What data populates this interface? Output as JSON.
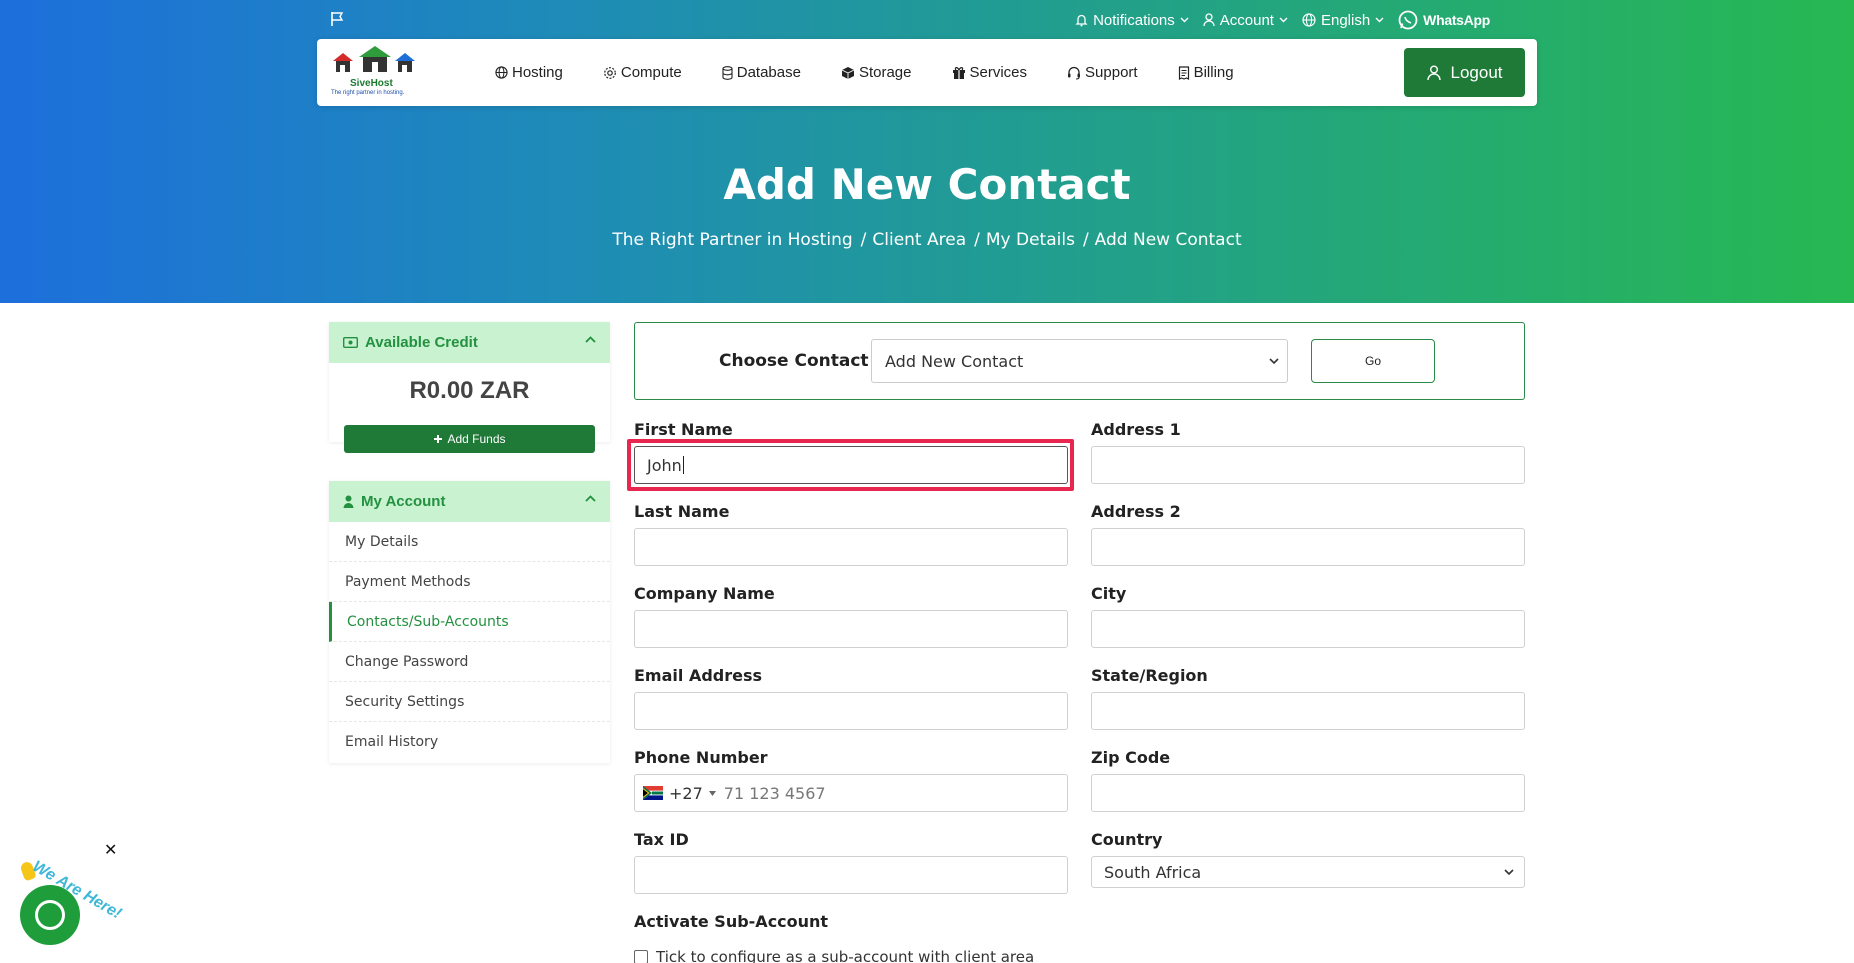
{
  "topbar": {
    "notifications": "Notifications",
    "account": "Account",
    "language": "English",
    "whatsapp": "WhatsApp"
  },
  "logo": {
    "name": "SiveHost",
    "tagline": "The right partner in hosting."
  },
  "nav": {
    "items": [
      {
        "label": "Hosting",
        "icon": "globe-icon"
      },
      {
        "label": "Compute",
        "icon": "gear-icon"
      },
      {
        "label": "Database",
        "icon": "database-icon"
      },
      {
        "label": "Storage",
        "icon": "box-icon"
      },
      {
        "label": "Services",
        "icon": "gift-icon"
      },
      {
        "label": "Support",
        "icon": "headset-icon"
      },
      {
        "label": "Billing",
        "icon": "receipt-icon"
      }
    ],
    "logout": "Logout"
  },
  "hero": {
    "title": "Add New Contact",
    "breadcrumb": [
      "The Right Partner in Hosting",
      "Client Area",
      "My Details",
      "Add New Contact"
    ]
  },
  "sidebar": {
    "credit": {
      "title": "Available Credit",
      "amount": "R0.00 ZAR",
      "add_funds": "Add Funds"
    },
    "account": {
      "title": "My Account",
      "items": [
        {
          "label": "My Details",
          "active": false
        },
        {
          "label": "Payment Methods",
          "active": false
        },
        {
          "label": "Contacts/Sub-Accounts",
          "active": true
        },
        {
          "label": "Change Password",
          "active": false
        },
        {
          "label": "Security Settings",
          "active": false
        },
        {
          "label": "Email History",
          "active": false
        }
      ]
    }
  },
  "form": {
    "choose_label": "Choose Contact",
    "choose_value": "Add New Contact",
    "go": "Go",
    "first_name": {
      "label": "First Name",
      "value": "John"
    },
    "last_name": {
      "label": "Last Name",
      "value": ""
    },
    "company": {
      "label": "Company Name",
      "value": ""
    },
    "email": {
      "label": "Email Address",
      "value": ""
    },
    "phone": {
      "label": "Phone Number",
      "code": "+27",
      "placeholder": "71 123 4567"
    },
    "tax_id": {
      "label": "Tax ID",
      "value": ""
    },
    "address1": {
      "label": "Address 1",
      "value": ""
    },
    "address2": {
      "label": "Address 2",
      "value": ""
    },
    "city": {
      "label": "City",
      "value": ""
    },
    "state": {
      "label": "State/Region",
      "value": ""
    },
    "zip": {
      "label": "Zip Code",
      "value": ""
    },
    "country": {
      "label": "Country",
      "value": "South Africa"
    },
    "sub_account_label": "Activate Sub-Account",
    "sub_account_checkbox": "Tick to configure as a sub-account with client area"
  },
  "chat": {
    "text": "We Are Here!"
  },
  "colors": {
    "primary_green": "#1f7a38",
    "highlight": "#e8264f",
    "panel_head": "#c8f2d0"
  }
}
